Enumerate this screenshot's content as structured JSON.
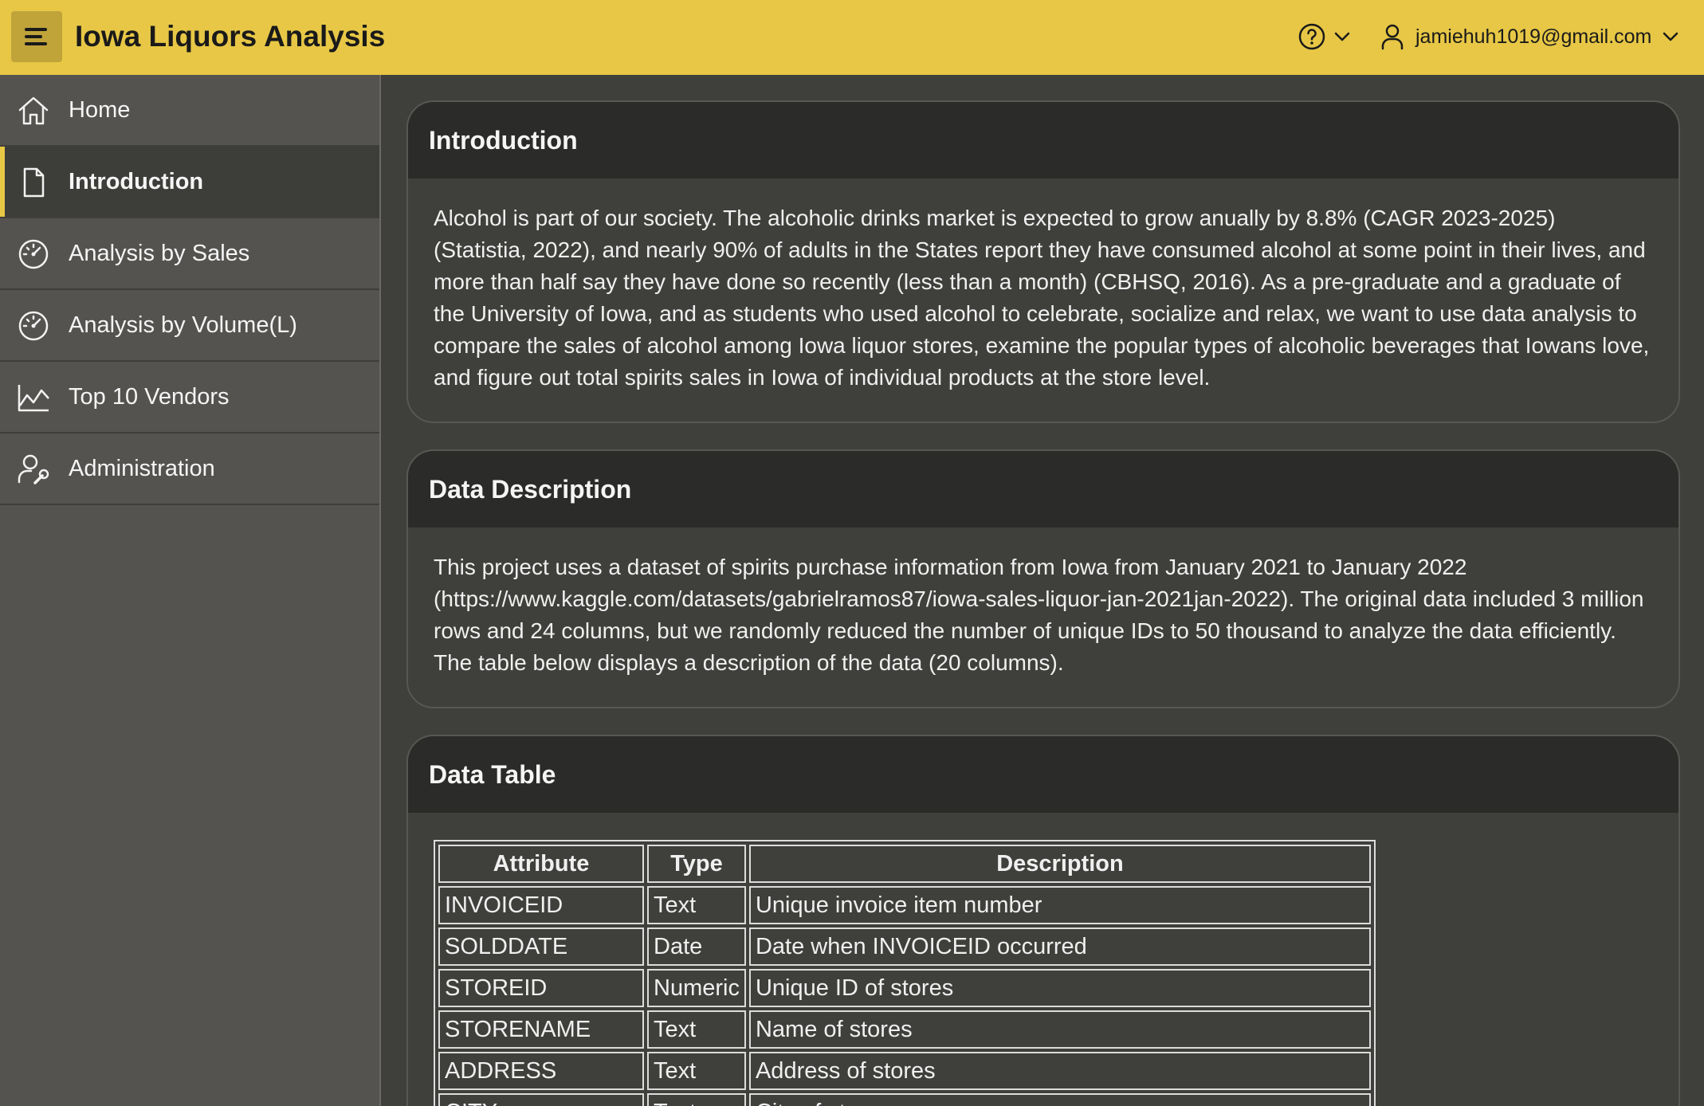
{
  "app": {
    "title": "Iowa Liquors Analysis",
    "user": "jamiehuh1019@gmail.com"
  },
  "sidebar": {
    "items": [
      {
        "label": "Home",
        "icon": "home-icon"
      },
      {
        "label": "Introduction",
        "icon": "document-icon",
        "active": true
      },
      {
        "label": "Analysis by Sales",
        "icon": "gauge-icon"
      },
      {
        "label": "Analysis by Volume(L)",
        "icon": "gauge-icon"
      },
      {
        "label": "Top 10 Vendors",
        "icon": "line-chart-icon"
      },
      {
        "label": "Administration",
        "icon": "user-wrench-icon"
      }
    ]
  },
  "introduction": {
    "title": "Introduction",
    "text": "Alcohol is part of our society. The alcoholic drinks market is expected to grow anually by 8.8% (CAGR 2023-2025) (Statistia, 2022), and nearly 90% of adults in the States report they have consumed alcohol at some point in their lives, and more than half say they have done so recently (less than a month) (CBHSQ, 2016). As a pre-graduate and a graduate of the University of Iowa, and as students who used alcohol to celebrate, socialize and relax, we want to use data analysis to compare the sales of alcohol among Iowa liquor stores, examine the popular types of alcoholic beverages that Iowans love, and figure out total spirits sales in Iowa of individual products at the store level."
  },
  "data_description": {
    "title": "Data Description",
    "text": "This project uses a dataset of spirits purchase information from Iowa from January 2021 to January 2022 (https://www.kaggle.com/datasets/gabrielramos87/iowa-sales-liquor-jan-2021jan-2022). The original data included 3 million rows and 24 columns, but we randomly reduced the number of unique IDs to 50 thousand to analyze the data efficiently. The table below displays a description of the data (20 columns)."
  },
  "data_table": {
    "title": "Data Table",
    "columns": [
      "Attribute",
      "Type",
      "Description"
    ],
    "rows": [
      [
        "INVOICEID",
        "Text",
        "Unique invoice item number"
      ],
      [
        "SOLDDATE",
        "Date",
        "Date when INVOICEID occurred"
      ],
      [
        "STOREID",
        "Numeric",
        "Unique ID of stores"
      ],
      [
        "STORENAME",
        "Text",
        "Name of stores"
      ],
      [
        "ADDRESS",
        "Text",
        "Address of stores"
      ],
      [
        "CITY",
        "Text",
        "City of stores"
      ]
    ]
  },
  "colors": {
    "header": "#e7c745",
    "sidebar": "#545350",
    "background": "#3f3f3c",
    "card_header": "#2b2b29"
  }
}
